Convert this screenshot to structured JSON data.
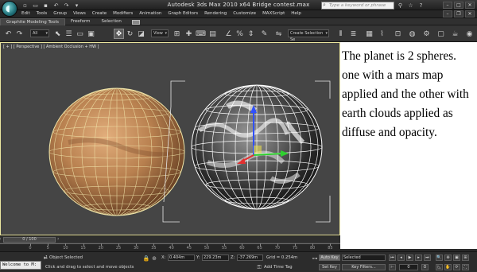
{
  "window": {
    "title": "Autodesk 3ds Max  2010 x64    Bridge contest.max",
    "search_placeholder": "Type a keyword or phrase"
  },
  "menu": [
    "Edit",
    "Tools",
    "Group",
    "Views",
    "Create",
    "Modifiers",
    "Animation",
    "Graph Editors",
    "Rendering",
    "Customize",
    "MAXScript",
    "Help"
  ],
  "ribbon": {
    "tabs": [
      "Graphite Modeling Tools",
      "Freeform",
      "Selection"
    ]
  },
  "toolbar": {
    "filter_value": "All",
    "reference_coord": "View",
    "named_selection": "Create Selection Se"
  },
  "viewport": {
    "label": "[ + ] [ Perspective ] [ Ambient Occlusion + HW ]"
  },
  "note": {
    "text": "The planet is 2 spheres. one with a mars map applied and the other with earth clouds applied as diffuse and opacity."
  },
  "timeline": {
    "frame_display": "0 / 100",
    "ruler_labels": [
      "0",
      "5",
      "10",
      "15",
      "20",
      "25",
      "30",
      "35",
      "40",
      "45",
      "50",
      "55",
      "60",
      "65",
      "70",
      "75",
      "80",
      "85"
    ]
  },
  "status": {
    "listener": "Welcome to M:",
    "selection_info": "1 Object Selected",
    "prompt": "Click and drag to select and move objects",
    "x_label": "X:",
    "x_value": "0.404m",
    "y_label": "Y:",
    "y_value": "229.23m",
    "z_label": "Z:",
    "z_value": "-37.269m",
    "grid": "Grid = 0.254m",
    "add_time_tag": "Add Time Tag",
    "auto_key": "Auto Key",
    "set_key": "Set Key",
    "key_mode": "Selected",
    "key_filters": "Key Filters...",
    "current_frame": "0"
  },
  "colors": {
    "selection_highlight": "#ebe6a0",
    "mars_sphere": "#c08a5b",
    "earth_wire": "#ffffff",
    "gizmo_x": "#e23030",
    "gizmo_y": "#2fd12f",
    "gizmo_z": "#3050ff"
  }
}
